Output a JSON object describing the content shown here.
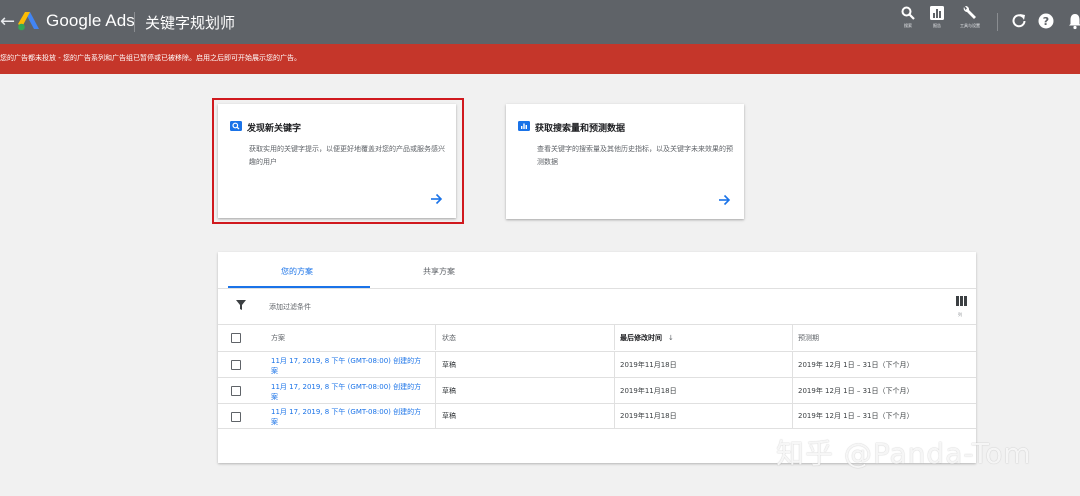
{
  "topbar": {
    "back_glyph": "←",
    "brand": "Google Ads",
    "page_title": "关键字规划师",
    "tools": [
      {
        "icon": "search-icon",
        "label": "搜索"
      },
      {
        "icon": "reports-icon",
        "label": "报告"
      },
      {
        "icon": "wrench-icon",
        "label": "工具与设置"
      }
    ],
    "refresh_icon": "refresh-icon",
    "help_icon": "help-icon",
    "bell_icon": "bell-icon"
  },
  "alert": {
    "text": "您的广告都未投放 - 您的广告系列和广告组已暂停或已被移除。启用之后即可开始展示您的广告。",
    "color": "#c5362a"
  },
  "cards": [
    {
      "icon": "search-icon",
      "title": "发现新关键字",
      "desc": "获取实用的关键字提示，以便更好地覆盖对您的产品或服务感兴趣的用户",
      "arrow": "arrow-right-icon"
    },
    {
      "icon": "bar-chart-icon",
      "title": "获取搜索量和预测数据",
      "desc": "查看关键字的搜索量及其他历史指标，以及关键字未来效果的预测数据",
      "arrow": "arrow-right-icon"
    }
  ],
  "plans": {
    "tabs": [
      {
        "label": "您的方案",
        "active": true
      },
      {
        "label": "共享方案",
        "active": false
      }
    ],
    "filter_label": "添加过滤条件",
    "columns_caption": "列",
    "headers": [
      "方案",
      "状态",
      "最后修改时间",
      "预测期"
    ],
    "sort_glyph": "↓",
    "rows": [
      {
        "plan": "11月 17, 2019, 8 下午 (GMT-08:00) 创建的方案",
        "status": "草稿",
        "modified": "2019年11月18日",
        "period": "2019年 12月 1日 – 31日（下个月）"
      },
      {
        "plan": "11月 17, 2019, 8 下午 (GMT-08:00) 创建的方案",
        "status": "草稿",
        "modified": "2019年11月18日",
        "period": "2019年 12月 1日 – 31日（下个月）"
      },
      {
        "plan": "11月 17, 2019, 8 下午 (GMT-08:00) 创建的方案",
        "status": "草稿",
        "modified": "2019年11月18日",
        "period": "2019年 12月 1日 – 31日（下个月）"
      }
    ]
  },
  "watermark": "知乎 @Panda-Tom",
  "colors": {
    "accent": "#1a73e8",
    "topbar": "#5f6368",
    "highlight": "#d0191e"
  }
}
